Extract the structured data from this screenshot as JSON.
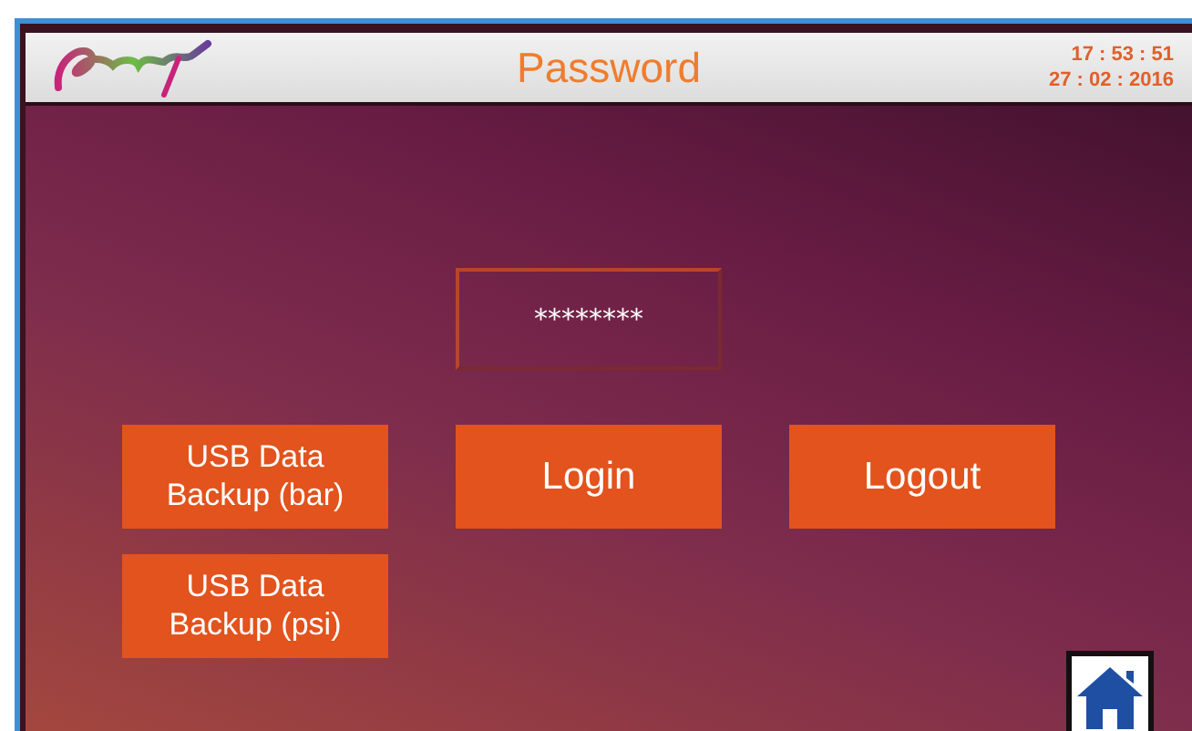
{
  "header": {
    "title": "Password",
    "time": "17 : 53 : 51",
    "date": "27 : 02 : 2016"
  },
  "password_field": {
    "value": "********"
  },
  "buttons": [
    {
      "label": "USB Data\nBackup (bar)",
      "kind": "backup"
    },
    {
      "label": "Login",
      "kind": "main"
    },
    {
      "label": "Logout",
      "kind": "main"
    },
    {
      "label": "USB Data\nBackup (psi)",
      "kind": "backup"
    }
  ]
}
